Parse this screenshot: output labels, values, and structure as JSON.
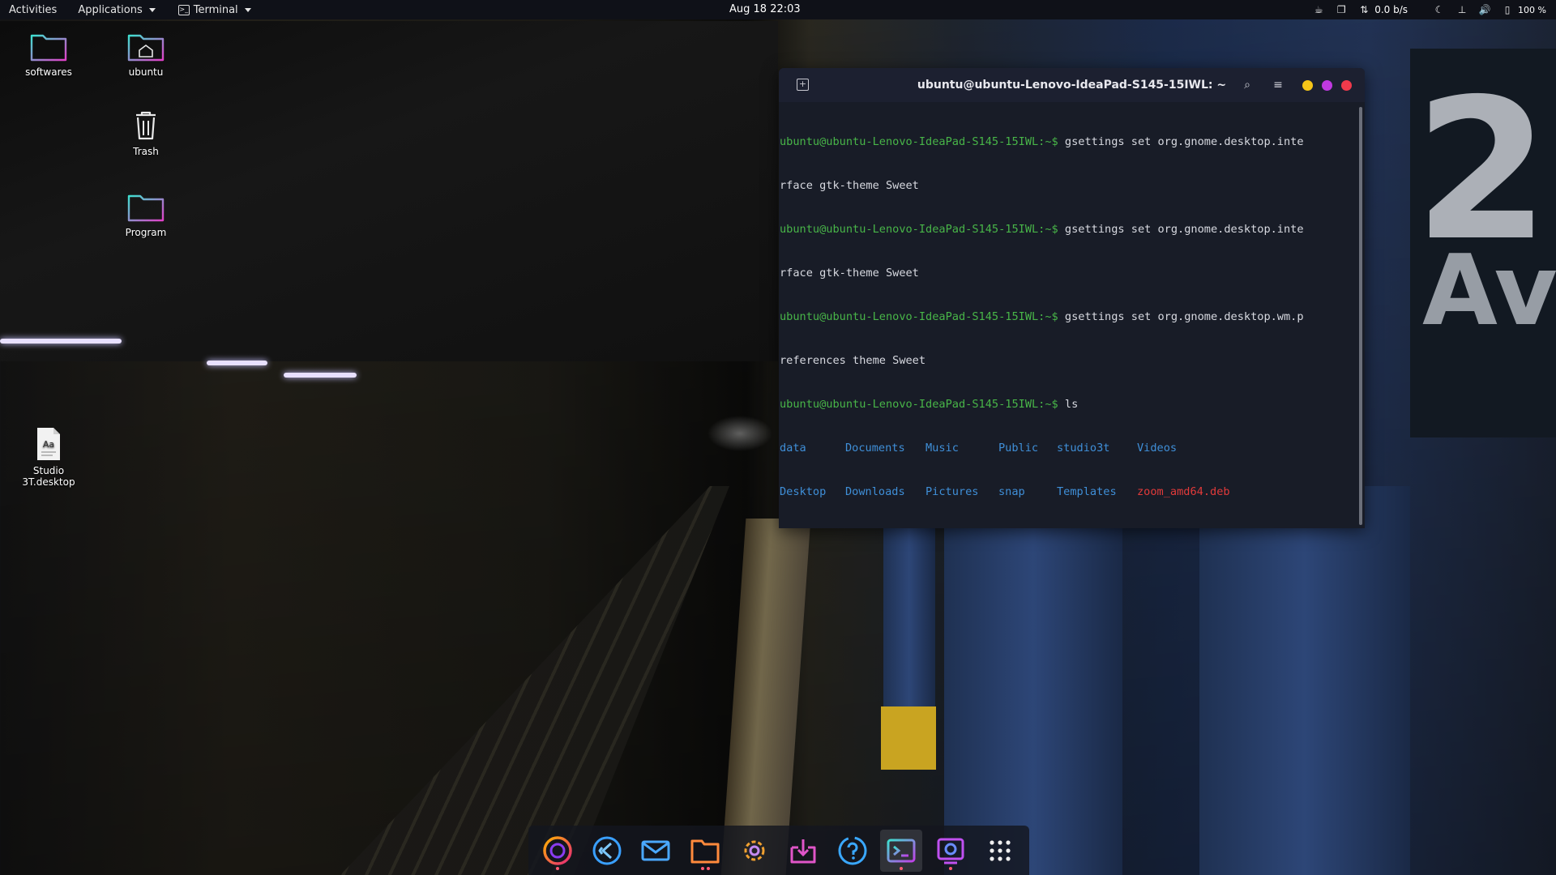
{
  "topbar": {
    "activities": "Activities",
    "applications": "Applications",
    "terminal_menu": "Terminal",
    "clock": "Aug 18  22:03",
    "net_speed": "0.0  b/s",
    "battery": "100 %"
  },
  "desktop": {
    "icons": [
      {
        "label": "softwares"
      },
      {
        "label": "ubuntu"
      },
      {
        "label": "Trash"
      },
      {
        "label": "Program"
      },
      {
        "label": "Studio 3T.desktop"
      }
    ]
  },
  "terminal": {
    "title": "ubuntu@ubuntu-Lenovo-IdeaPad-S145-15IWL: ~",
    "prompt": "ubuntu@ubuntu-Lenovo-IdeaPad-S145-15IWL:~$",
    "lines": [
      {
        "cmd": " gsettings set org.gnome.desktop.inte",
        "wrap": "rface gtk-theme Sweet"
      },
      {
        "cmd": " gsettings set org.gnome.desktop.inte",
        "wrap": "rface gtk-theme Sweet"
      },
      {
        "cmd": " gsettings set org.gnome.desktop.wm.p",
        "wrap": "references theme Sweet"
      },
      {
        "cmd": " ls",
        "wrap": ""
      }
    ],
    "ls_row1": [
      "data",
      "Documents",
      "Music",
      "Public",
      "studio3t",
      "Videos"
    ],
    "ls_row2": [
      "Desktop",
      "Downloads",
      "Pictures",
      "snap",
      "Templates",
      "zoom_amd64.deb"
    ],
    "colors": {
      "prompt": "#48b548",
      "dir": "#3f8fd8",
      "deb": "#e23a3a",
      "min": "#f5c518",
      "max": "#c039e0",
      "close": "#f03a4b"
    }
  },
  "wallpaper": {
    "sign_number": "2",
    "sign_text": "Av"
  },
  "dock": {
    "apps": [
      "firefox-icon",
      "vscode-icon",
      "mail-icon",
      "files-icon",
      "settings-icon",
      "software-center-icon",
      "help-icon",
      "terminal-icon",
      "screenshot-icon",
      "app-grid-icon"
    ]
  }
}
